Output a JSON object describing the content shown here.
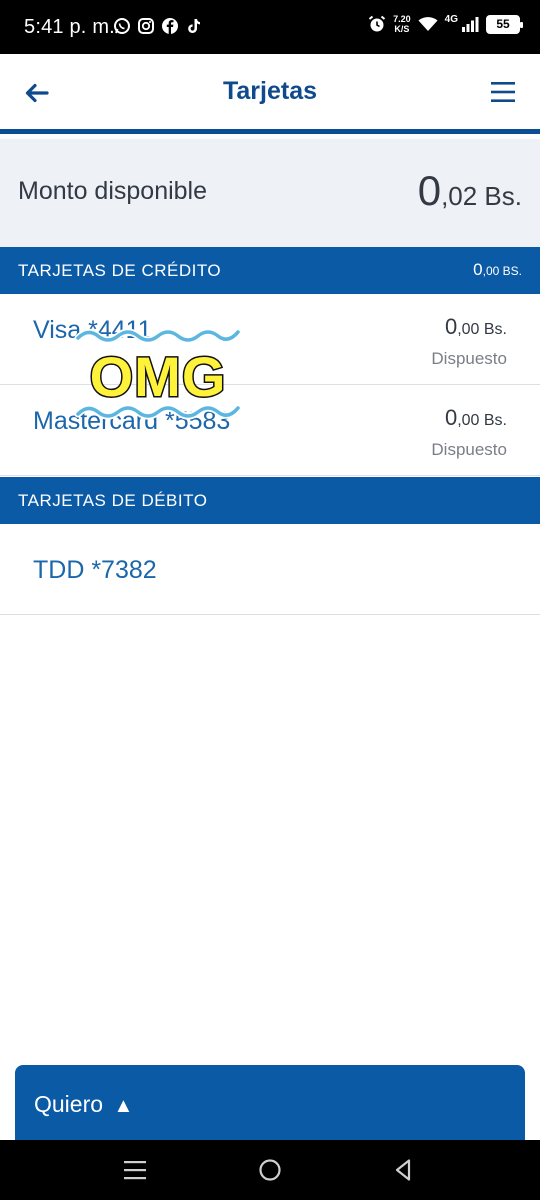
{
  "status_bar": {
    "time": "5:41 p. m.",
    "speed_value": "7.20",
    "speed_unit": "K/S",
    "network": "4G",
    "battery": "55",
    "app_icons": [
      "whatsapp-icon",
      "instagram-icon",
      "facebook-icon",
      "tiktok-icon"
    ],
    "system_icons": [
      "alarm-icon",
      "wifi-icon",
      "signal-icon",
      "battery-icon"
    ]
  },
  "header": {
    "title": "Tarjetas"
  },
  "available": {
    "label": "Monto disponible",
    "amount_int": "0",
    "amount_dec": ",02 Bs."
  },
  "credit": {
    "title": "TARJETAS DE CRÉDITO",
    "total_int": "0",
    "total_dec": ",00 BS.",
    "cards": [
      {
        "name": "Visa *4411",
        "amount_int": "0",
        "amount_dec": ",00 Bs.",
        "status": "Dispuesto"
      },
      {
        "name": "Mastercard *5583",
        "amount_int": "0",
        "amount_dec": ",00 Bs.",
        "status": "Dispuesto"
      }
    ]
  },
  "debit": {
    "title": "TARJETAS DE DÉBITO",
    "cards": [
      {
        "name": "TDD *7382"
      }
    ]
  },
  "sticker": {
    "text": "OMG"
  },
  "bottom_sheet": {
    "label": "Quiero",
    "arrow": "▲"
  },
  "colors": {
    "brand_blue": "#0b5aa6",
    "title_blue": "#0e4a8c",
    "link_blue": "#1c66ab",
    "panel_bg": "#eef2f6"
  }
}
